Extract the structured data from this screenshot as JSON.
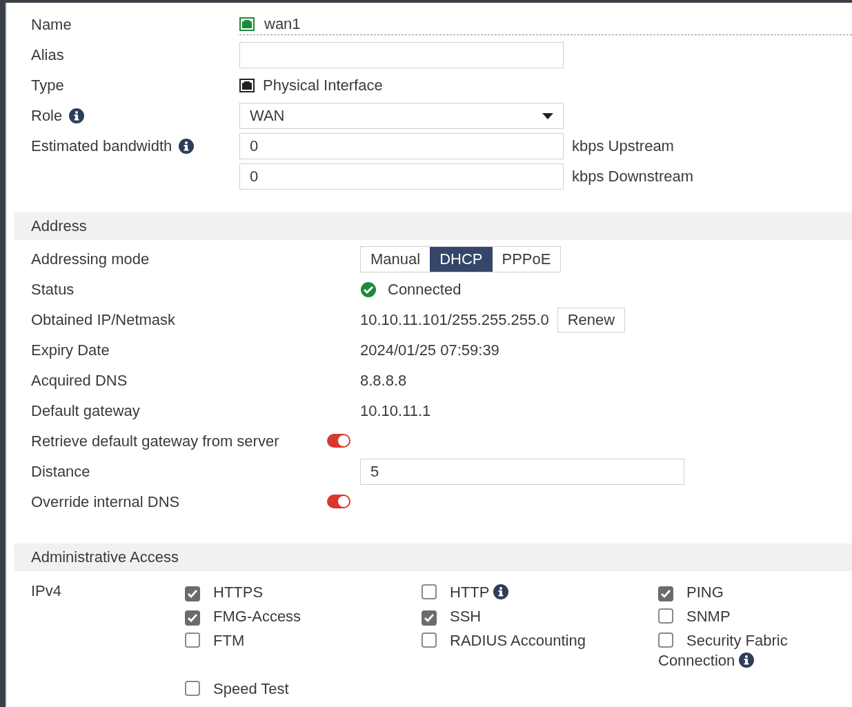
{
  "interface": {
    "fields": [
      {
        "kind": "name",
        "label": "Name",
        "value": "wan1"
      },
      {
        "kind": "input",
        "label": "Alias"
      },
      {
        "kind": "type",
        "label": "Type",
        "value": "Physical Interface"
      },
      {
        "kind": "select",
        "label": "Role",
        "info": true,
        "value": "WAN"
      },
      {
        "kind": "input",
        "label": "Estimated bandwidth",
        "info": true,
        "value": "0",
        "unit": "kbps Upstream"
      },
      {
        "kind": "input",
        "value": "0",
        "unit": "kbps Downstream"
      }
    ]
  },
  "address": {
    "title": "Address",
    "fields": [
      {
        "kind": "segmented",
        "label": "Addressing mode",
        "options": [
          {
            "label": "Manual",
            "selected": false
          },
          {
            "label": "DHCP",
            "selected": true
          },
          {
            "label": "PPPoE",
            "selected": false
          }
        ]
      },
      {
        "kind": "status",
        "label": "Status",
        "value": "Connected"
      },
      {
        "kind": "text",
        "label": "Obtained IP/Netmask",
        "value": "10.10.11.101/255.255.255.0",
        "button": "Renew"
      },
      {
        "kind": "text",
        "label": "Expiry Date",
        "value": "2024/01/25 07:59:39"
      },
      {
        "kind": "text",
        "label": "Acquired DNS",
        "value": "8.8.8.8"
      },
      {
        "kind": "text",
        "label": "Default gateway",
        "value": "10.10.11.1"
      },
      {
        "kind": "toggle",
        "label": "Retrieve default gateway from server",
        "on": true
      },
      {
        "kind": "input",
        "label": "Distance",
        "value": "5"
      },
      {
        "kind": "toggle",
        "label": "Override internal DNS",
        "on": true
      }
    ]
  },
  "admin": {
    "title": "Administrative Access",
    "label": "IPv4",
    "options": [
      {
        "label": "HTTPS",
        "checked": true
      },
      {
        "label": "HTTP",
        "checked": false,
        "info": true
      },
      {
        "label": "PING",
        "checked": true
      },
      {
        "label": "FMG-Access",
        "checked": true
      },
      {
        "label": "SSH",
        "checked": true
      },
      {
        "label": "SNMP",
        "checked": false
      },
      {
        "label": "FTM",
        "checked": false
      },
      {
        "label": "RADIUS Accounting",
        "checked": false
      },
      {
        "label": "Security Fabric Connection",
        "checked": false,
        "info": true
      },
      {
        "label": "Speed Test",
        "checked": false
      }
    ]
  }
}
